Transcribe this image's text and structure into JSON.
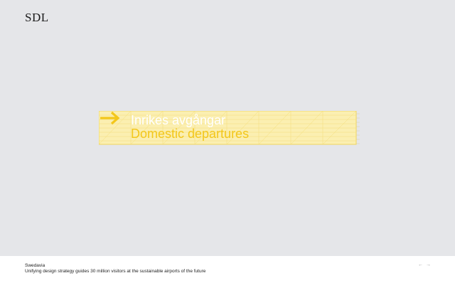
{
  "brand": {
    "logo_text": "SDL"
  },
  "sign": {
    "line1": "Inrikes avgångar",
    "line2": "Domestic departures",
    "arrow_icon": "arrow-right-icon",
    "colors": {
      "accent": "#f3c71b",
      "panel": "#fbefb1",
      "text_primary": "#ffffff"
    }
  },
  "footer": {
    "client": "Swedavia",
    "description": "Unifying design strategy guides 30 million visitors at the sustainable airports of the future",
    "nav": {
      "prev": "←",
      "next": "→"
    }
  }
}
